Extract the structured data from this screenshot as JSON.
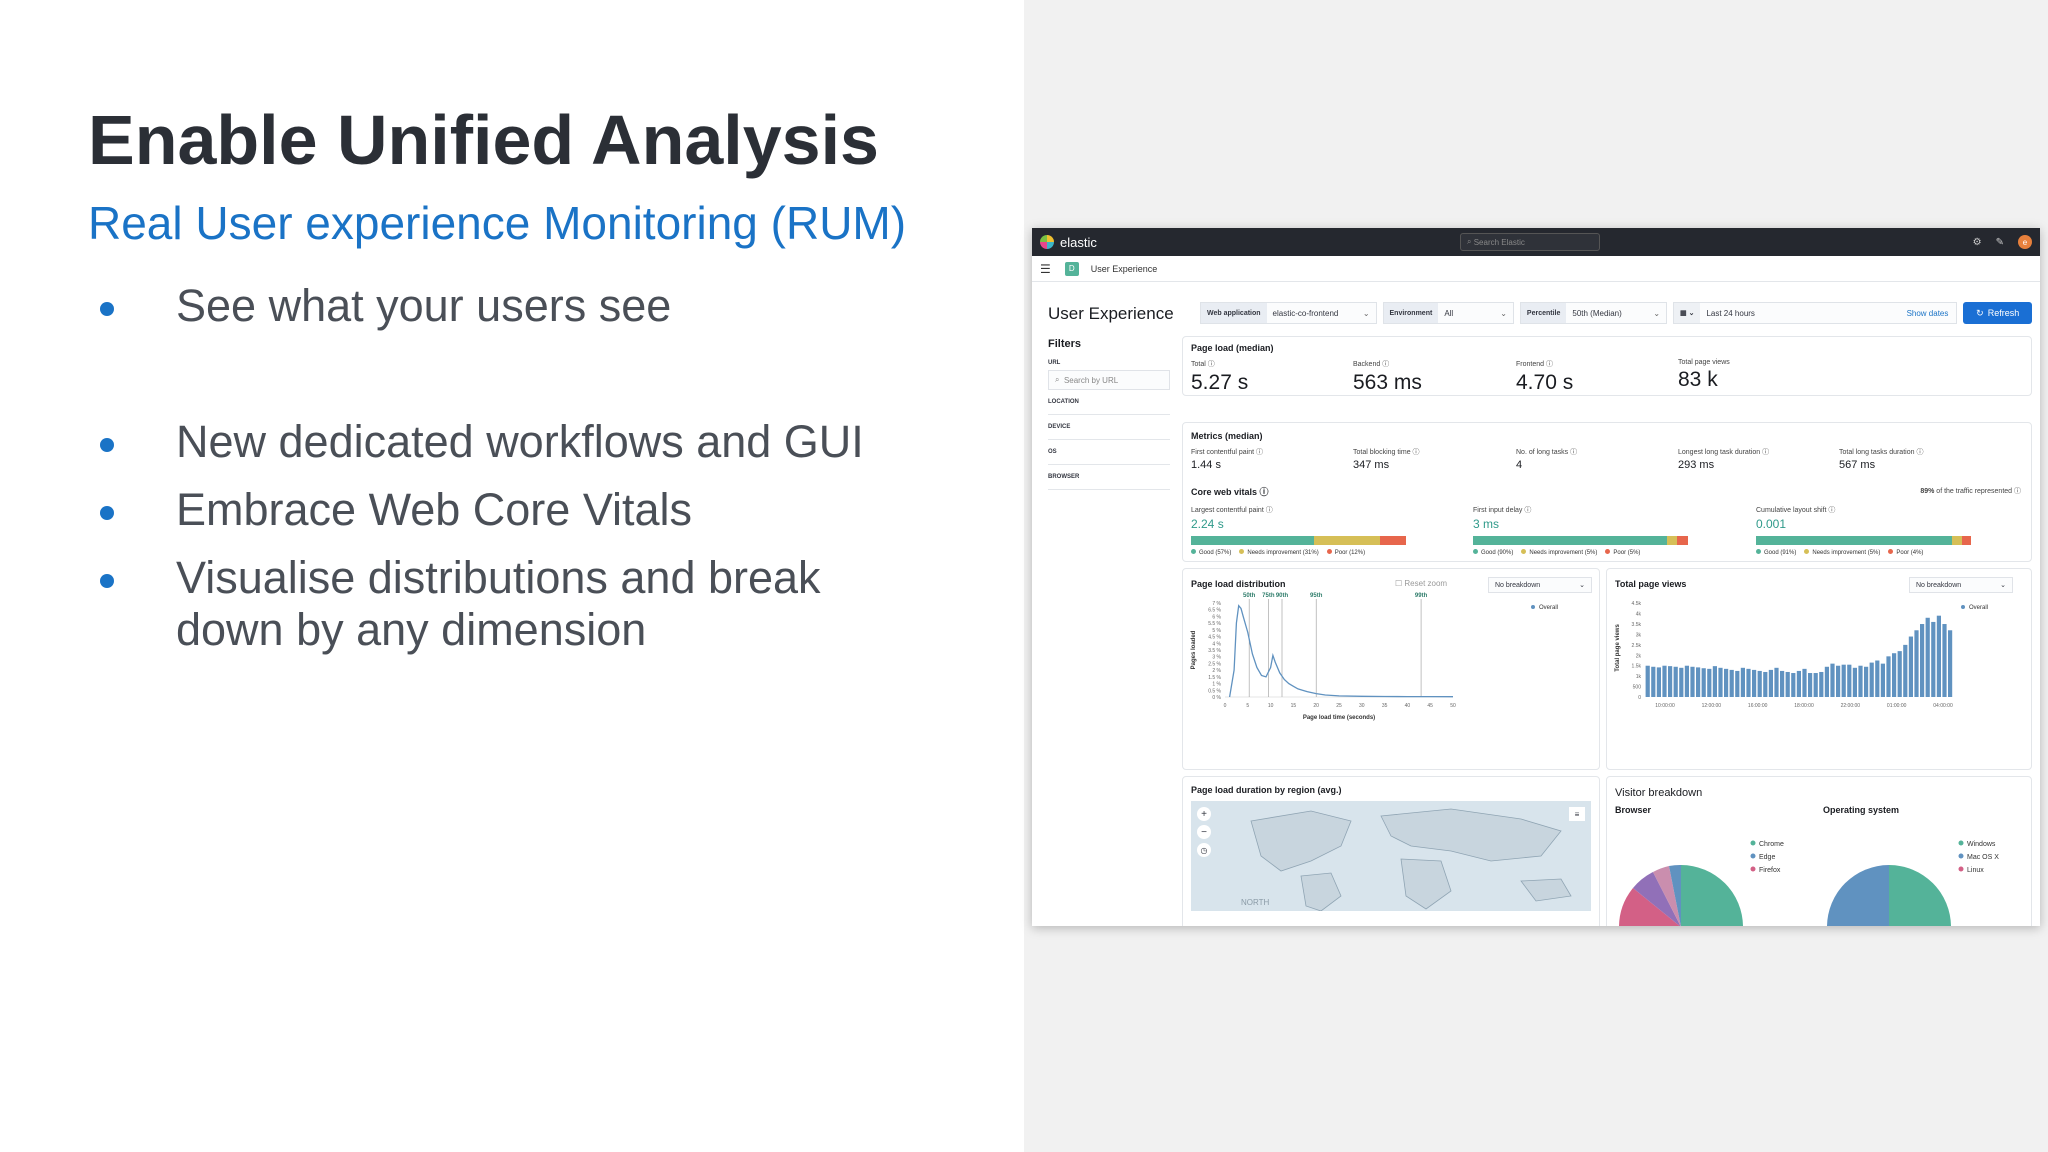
{
  "slide": {
    "title": "Enable Unified Analysis",
    "subtitle": "Real User experience Monitoring (RUM)",
    "bullets": [
      "See what your users see",
      "New dedicated workflows and GUI",
      "Embrace Web Core Vitals",
      "Visualise distributions and break down by any dimension"
    ]
  },
  "app": {
    "brand": "elastic",
    "search_placeholder": "Search Elastic",
    "avatar_initial": "e",
    "breadcrumb_badge": "D",
    "breadcrumb": "User Experience",
    "page_title": "User Experience",
    "controls": {
      "web_app_label": "Web application",
      "web_app_value": "elastic-co-frontend",
      "env_label": "Environment",
      "env_value": "All",
      "pct_label": "Percentile",
      "pct_value": "50th (Median)",
      "time_value": "Last 24 hours",
      "show_dates": "Show dates",
      "refresh": "Refresh"
    },
    "filters": {
      "title": "Filters",
      "url_label": "URL",
      "url_placeholder": "Search by URL",
      "groups": [
        "LOCATION",
        "DEVICE",
        "OS",
        "BROWSER"
      ]
    },
    "page_load": {
      "title": "Page load (median)",
      "stats": [
        {
          "label": "Total",
          "value": "5.27 s"
        },
        {
          "label": "Backend",
          "value": "563 ms"
        },
        {
          "label": "Frontend",
          "value": "4.70 s"
        },
        {
          "label": "Total page views",
          "value": "83 k"
        }
      ]
    },
    "metrics": {
      "title": "Metrics (median)",
      "stats": [
        {
          "label": "First contentful paint",
          "value": "1.44 s"
        },
        {
          "label": "Total blocking time",
          "value": "347 ms"
        },
        {
          "label": "No. of long tasks",
          "value": "4"
        },
        {
          "label": "Longest long task duration",
          "value": "293 ms"
        },
        {
          "label": "Total long tasks duration",
          "value": "567 ms"
        }
      ]
    },
    "core_web_vitals": {
      "title": "Core web vitals",
      "traffic_pct": "89%",
      "traffic_text": "of the traffic represented",
      "items": [
        {
          "label": "Largest contentful paint",
          "value": "2.24 s",
          "good": 57,
          "ni": 31,
          "poor": 12,
          "legend": [
            "Good (57%)",
            "Needs improvement (31%)",
            "Poor (12%)"
          ]
        },
        {
          "label": "First input delay",
          "value": "3 ms",
          "good": 90,
          "ni": 5,
          "poor": 5,
          "legend": [
            "Good (90%)",
            "Needs improvement (5%)",
            "Poor (5%)"
          ]
        },
        {
          "label": "Cumulative layout shift",
          "value": "0.001",
          "good": 91,
          "ni": 5,
          "poor": 4,
          "legend": [
            "Good (91%)",
            "Needs improvement (5%)",
            "Poor (4%)"
          ]
        }
      ]
    },
    "page_load_dist": {
      "title": "Page load distribution",
      "reset_zoom": "Reset zoom",
      "breakdown": "No breakdown",
      "legend": "Overall",
      "xlabel": "Page load time (seconds)",
      "ylabel": "Pages loaded"
    },
    "total_page_views": {
      "title": "Total page views",
      "breakdown": "No breakdown",
      "legend": "Overall",
      "ylabel": "Total page views"
    },
    "region": {
      "title": "Page load duration by region (avg.)",
      "map_label": "NORTH"
    },
    "visitor": {
      "title": "Visitor breakdown",
      "browser_title": "Browser",
      "os_title": "Operating system",
      "browser_legend": [
        "Chrome",
        "Edge",
        "Firefox"
      ],
      "os_legend": [
        "Windows",
        "Mac OS X",
        "Linux"
      ]
    },
    "colors": {
      "good": "#54b399",
      "needs_improvement": "#d6bf57",
      "poor": "#e7664c",
      "accent": "#1a6fd4",
      "series": "#6092c0"
    }
  },
  "chart_data": [
    {
      "type": "line",
      "title": "Page load distribution",
      "xlabel": "Page load time (seconds)",
      "ylabel": "Pages loaded",
      "xlim": [
        0,
        50
      ],
      "ylim": [
        0,
        7
      ],
      "x_ticks": [
        "0",
        "5",
        "10",
        "15",
        "20",
        "25",
        "30",
        "35",
        "40",
        "45",
        "50"
      ],
      "y_ticks": [
        "0 %",
        "0.5 %",
        "1 %",
        "1.5 %",
        "2 %",
        "2.5 %",
        "3 %",
        "3.5 %",
        "4 %",
        "4.5 %",
        "5 %",
        "5.5 %",
        "6 %",
        "6.5 %",
        "7 %"
      ],
      "percentile_markers": [
        {
          "label": "50th",
          "x": 5.3
        },
        {
          "label": "75th",
          "x": 9.5
        },
        {
          "label": "90th",
          "x": 12.5
        },
        {
          "label": "95th",
          "x": 20
        },
        {
          "label": "99th",
          "x": 43
        }
      ],
      "series": [
        {
          "name": "Overall",
          "x": [
            1,
            2,
            2.5,
            3,
            3.5,
            4,
            5,
            6,
            7,
            8,
            9,
            10,
            10.5,
            11,
            12,
            13,
            14,
            15,
            16,
            17,
            18,
            20,
            22,
            25,
            30,
            35,
            40,
            45,
            50
          ],
          "y": [
            0,
            2,
            5.5,
            6.8,
            6.6,
            6,
            4.8,
            3.2,
            2.2,
            1.6,
            1.5,
            2.2,
            3.1,
            2.6,
            1.8,
            1.3,
            1,
            0.8,
            0.6,
            0.5,
            0.4,
            0.25,
            0.15,
            0.08,
            0.05,
            0.04,
            0.03,
            0.03,
            0.02
          ]
        }
      ]
    },
    {
      "type": "bar",
      "title": "Total page views",
      "ylabel": "Total page views",
      "ylim": [
        0,
        4700
      ],
      "y_ticks": [
        "0",
        "500",
        "1k",
        "1.5k",
        "2k",
        "2.5k",
        "3k",
        "3.5k",
        "4k",
        "4.5k"
      ],
      "x_ticks": [
        "10:00:00",
        "12:00:00",
        "16:00:00",
        "18:00:00",
        "22:00:00",
        "01:00:00",
        "04:00:00"
      ],
      "series": [
        {
          "name": "Overall",
          "values": [
            1500,
            1450,
            1420,
            1500,
            1480,
            1450,
            1400,
            1500,
            1450,
            1420,
            1380,
            1350,
            1480,
            1400,
            1350,
            1300,
            1250,
            1400,
            1350,
            1300,
            1250,
            1200,
            1300,
            1400,
            1250,
            1200,
            1150,
            1250,
            1350,
            1150,
            1150,
            1200,
            1450,
            1600,
            1500,
            1550,
            1550,
            1400,
            1500,
            1450,
            1650,
            1750,
            1600,
            1950,
            2100,
            2200,
            2500,
            2900,
            3200,
            3500,
            3800,
            3600,
            3900,
            3500,
            3200
          ]
        }
      ]
    }
  ]
}
